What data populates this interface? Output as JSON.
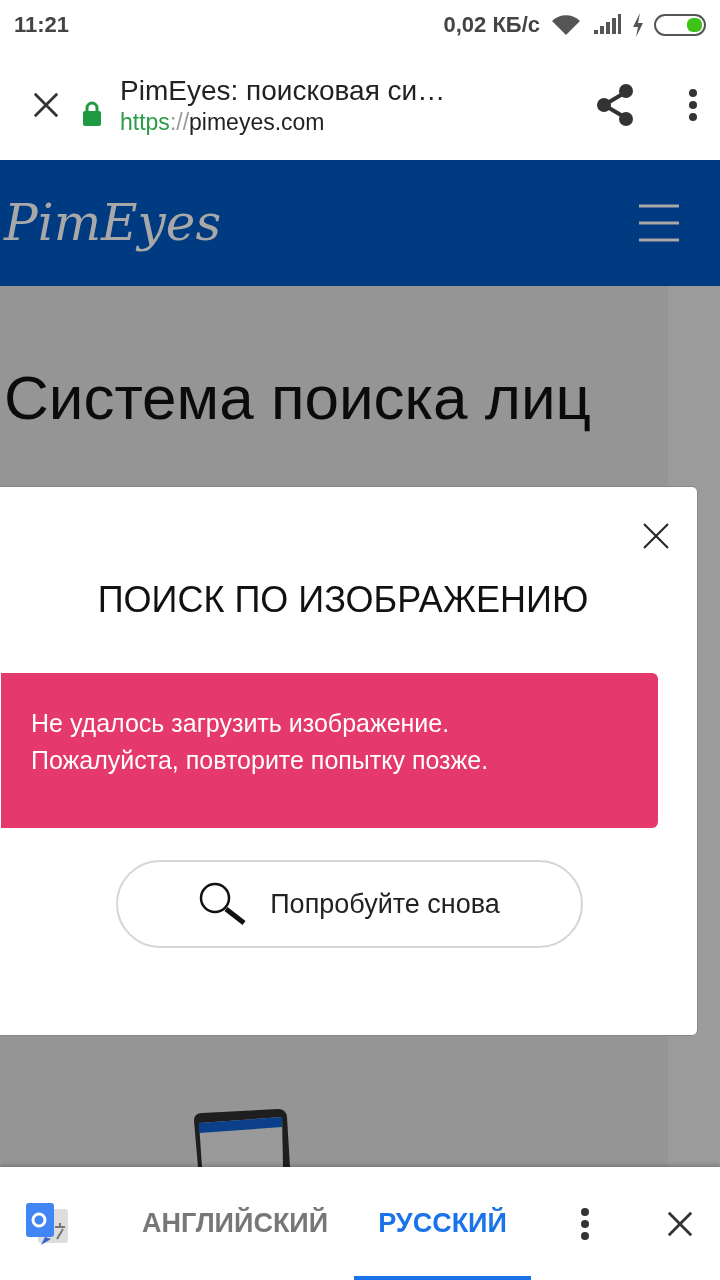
{
  "status_bar": {
    "time": "11:21",
    "speed": "0,02 КБ/с"
  },
  "toolbar": {
    "title": "PimEyes: поисковая си…",
    "url_scheme": "https",
    "url_sep": "://",
    "url_host": "pimeyes.com"
  },
  "site": {
    "logo": "PimEyes",
    "heading_lines": [
      "Система поиска лиц"
    ]
  },
  "dialog": {
    "title": "ПОИСК ПО ИЗОБРАЖЕНИЮ",
    "error": "Не удалось загрузить изображение. Пожалуйста, повторите попытку позже.",
    "button": "Попробуйте снова"
  },
  "translate_bar": {
    "languages": [
      {
        "label": "АНГЛИЙСКИЙ",
        "selected": false
      },
      {
        "label": "РУССКИЙ",
        "selected": true
      }
    ]
  }
}
